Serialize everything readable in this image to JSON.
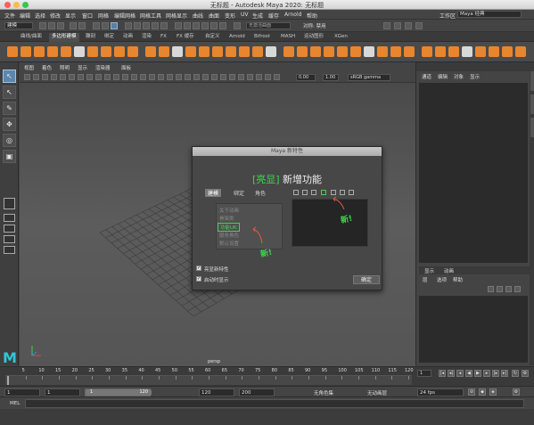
{
  "window": {
    "title": "无标题 - Autodesk Maya 2020: 无标题"
  },
  "menubar": {
    "items": [
      "文件",
      "编辑",
      "选择",
      "修改",
      "显示",
      "窗口",
      "网格",
      "编辑网格",
      "网格工具",
      "网格显示",
      "曲线",
      "曲面",
      "变形",
      "UV",
      "生成",
      "缓存",
      "Arnold",
      "帮助"
    ],
    "workspace_label": "工作区",
    "workspace_value": "Maya 经典"
  },
  "statusline": {
    "mode": "建模",
    "no_live_surface": "无激活曲面",
    "symmetry": "对称: 禁用"
  },
  "shelf": {
    "tabs": [
      "曲线/曲面",
      "多边形建模",
      "雕刻",
      "绑定",
      "动画",
      "渲染",
      "FX",
      "FX 缓存",
      "自定义",
      "Arnold",
      "Bifrost",
      "MASH",
      "运动图形",
      "XGen"
    ],
    "active_tab": 1,
    "icon_color": "#e8852f"
  },
  "viewport": {
    "menu": [
      "视图",
      "着色",
      "照明",
      "显示",
      "渲染器",
      "面板"
    ],
    "field_near": "0.00",
    "field_gamma": "1.00",
    "colorspace": "sRGB gamma",
    "camera": "persp"
  },
  "channel_box": {
    "tabs": [
      "通道",
      "编辑",
      "对象",
      "显示"
    ]
  },
  "layer_editor": {
    "tabs": [
      "显示",
      "动画"
    ],
    "menu": [
      "层",
      "选项",
      "帮助"
    ]
  },
  "timeline": {
    "ticks": [
      "5",
      "10",
      "15",
      "20",
      "25",
      "30",
      "35",
      "40",
      "45",
      "50",
      "55",
      "60",
      "65",
      "70",
      "75",
      "80",
      "85",
      "90",
      "95",
      "100",
      "105",
      "110",
      "115",
      "120"
    ],
    "current_frame": "1"
  },
  "range": {
    "start": "1",
    "playback_start": "1",
    "range_start": "1",
    "range_end": "120",
    "playback_end": "120",
    "end": "200",
    "character_set": "无角色集",
    "anim_layer": "无动画层",
    "fps": "24 fps"
  },
  "command_line": {
    "label": "MEL"
  },
  "dialog": {
    "title": "Maya 新特性",
    "heading_highlight": "[亮显]",
    "heading_text": "新增功能",
    "tabs": [
      "建模",
      "绑定",
      "角色"
    ],
    "list_items": [
      "关于动画",
      "骨架类",
      "功能UK",
      "服务角色",
      "默认设置"
    ],
    "new_tag_1": "新!",
    "new_tag_2": "新!",
    "checkbox_1": "亮显新特性",
    "checkbox_2": "启动时显示",
    "ok_label": "确定",
    "accent": "#3ed64b"
  }
}
